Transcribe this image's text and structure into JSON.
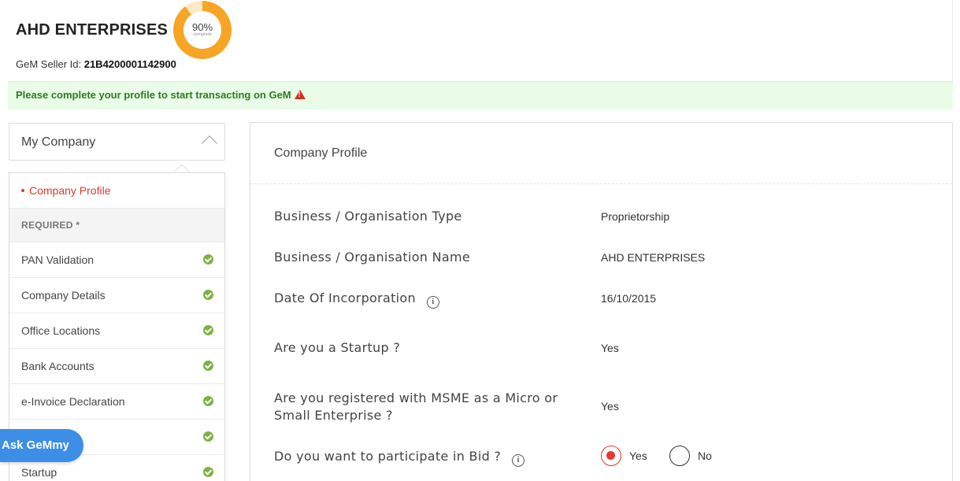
{
  "header": {
    "company_name": "AHD ENTERPRISES",
    "progress_percent": 90,
    "progress_label": "90%",
    "progress_sub": "complete",
    "seller_id_label": "GeM Seller Id:",
    "seller_id_value": "21B4200001142900"
  },
  "alert": {
    "text": "Please complete your profile to start transacting on GeM",
    "icon": "warning-triangle-icon"
  },
  "sidebar": {
    "dropdown_label": "My Company",
    "active_item": "Company Profile",
    "section_label": "REQUIRED *",
    "items": [
      {
        "label": "PAN Validation",
        "status": "complete"
      },
      {
        "label": "Company Details",
        "status": "complete"
      },
      {
        "label": "Office Locations",
        "status": "complete"
      },
      {
        "label": "Bank Accounts",
        "status": "complete"
      },
      {
        "label": "e-Invoice Declaration",
        "status": "complete"
      },
      {
        "label": "",
        "status": "complete"
      },
      {
        "label": "Startup",
        "status": "complete"
      }
    ]
  },
  "ask_button": "Ask GeMmy",
  "panel": {
    "title": "Company Profile",
    "rows": [
      {
        "label": "Business / Organisation Type",
        "value": "Proprietorship"
      },
      {
        "label": "Business / Organisation Name",
        "value": "AHD ENTERPRISES"
      },
      {
        "label": "Date Of Incorporation",
        "value": "16/10/2015"
      },
      {
        "label": "Are you a Startup ?",
        "value": "Yes"
      },
      {
        "label_line1": "Are you registered with MSME as a Micro or",
        "label_line2": "Small Enterprise ?",
        "value": "Yes"
      },
      {
        "label": "Do you want to participate in Bid ?",
        "options": [
          "Yes",
          "No"
        ],
        "selected": "Yes"
      }
    ]
  },
  "colors": {
    "accent_red": "#d93b2c",
    "success_green": "#7cb342",
    "progress_orange": "#f7a525",
    "ask_blue": "#3d8ee6"
  }
}
